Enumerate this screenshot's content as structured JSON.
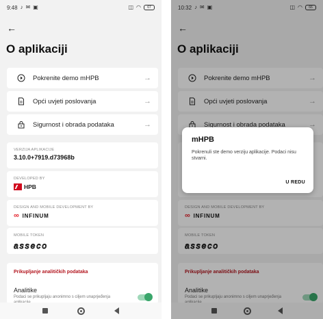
{
  "left": {
    "status": {
      "time": "9:48",
      "battery": "67"
    },
    "title": "O aplikaciji",
    "menu": [
      {
        "label": "Pokrenite demo mHPB",
        "icon": "play-circle-icon"
      },
      {
        "label": "Opći uvjeti poslovanja",
        "icon": "document-icon"
      },
      {
        "label": "Sigurnost i obrada podataka",
        "icon": "lock-icon"
      }
    ],
    "version": {
      "label": "VERZIJA APLIKACIJE",
      "value": "3.10.0+7919.d73968b"
    },
    "developed_by": {
      "label": "DEVELOPED BY",
      "logo_text": "HPB"
    },
    "design_by": {
      "label": "DESIGN AND MOBILE DEVELOPMENT BY",
      "logo_text": "INFINUM"
    },
    "mobile_token": {
      "label": "MOBILE TOKEN",
      "logo_text": "asseco"
    },
    "analytics": {
      "section_title": "Prikupljanje analitičkih podataka",
      "row_title": "Analitike",
      "row_sub": "Podaci se prikupljaju anonimno s ciljem unaprjeđenja aplikacije",
      "enabled": true
    }
  },
  "right": {
    "status": {
      "time": "10:32",
      "battery": "66"
    },
    "title": "O aplikaciji",
    "menu": [
      {
        "label": "Pokrenite demo mHPB"
      },
      {
        "label": "Opći uvjeti poslovanja"
      },
      {
        "label": "Sigurnost i obrada podataka"
      }
    ],
    "design_by": {
      "label": "DESIGN AND MOBILE DEVELOPMENT BY",
      "logo_text": "INFINUM"
    },
    "mobile_token": {
      "label": "MOBILE TOKEN",
      "logo_text": "asseco"
    },
    "analytics": {
      "section_title": "Prikupljanje analitičkih podataka",
      "row_title": "Analitike",
      "row_sub": "Podaci se prikupljaju anonimno s ciljem unaprjeđenja aplikacije"
    },
    "dialog": {
      "title": "mHPB",
      "message": "Pokrenuli ste demo verziju aplikacije. Podaci nisu stvarni.",
      "button": "U REDU"
    }
  },
  "colors": {
    "accent_red": "#b3161f",
    "toggle_green": "#3aa66b",
    "background": "#f2f2f2"
  }
}
